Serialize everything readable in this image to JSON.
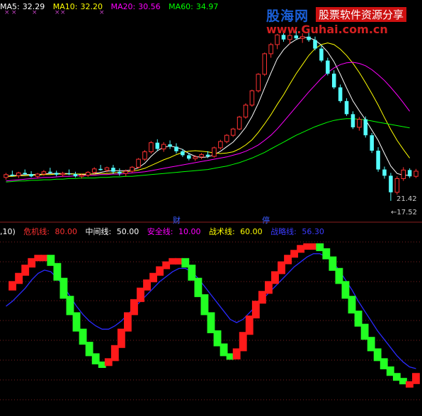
{
  "chart_data": [
    {
      "type": "candlestick",
      "legend": [
        {
          "label": "MA5:",
          "value": "32.29",
          "color": "#ffffff"
        },
        {
          "label": "MA10:",
          "value": "32.20",
          "color": "#ffff00"
        },
        {
          "label": "MA20:",
          "value": "30.56",
          "color": "#ff00ff"
        },
        {
          "label": "MA60:",
          "value": "34.97",
          "color": "#00ff00"
        }
      ],
      "ylim": [
        15.5,
        49
      ],
      "candles": [
        {
          "o": 21.6,
          "h": 22.4,
          "l": 21.2,
          "c": 22.1
        },
        {
          "o": 22.1,
          "h": 22.8,
          "l": 21.8,
          "c": 21.9
        },
        {
          "o": 21.9,
          "h": 22.6,
          "l": 21.5,
          "c": 22.4
        },
        {
          "o": 22.4,
          "h": 23.0,
          "l": 22.0,
          "c": 22.2
        },
        {
          "o": 22.2,
          "h": 22.7,
          "l": 21.6,
          "c": 21.8
        },
        {
          "o": 21.8,
          "h": 22.4,
          "l": 21.4,
          "c": 22.2
        },
        {
          "o": 22.2,
          "h": 22.9,
          "l": 21.9,
          "c": 22.6
        },
        {
          "o": 22.6,
          "h": 23.3,
          "l": 22.2,
          "c": 22.4
        },
        {
          "o": 22.4,
          "h": 22.8,
          "l": 21.8,
          "c": 22.1
        },
        {
          "o": 22.1,
          "h": 22.6,
          "l": 21.7,
          "c": 22.3
        },
        {
          "o": 22.3,
          "h": 23.0,
          "l": 22.0,
          "c": 22.2
        },
        {
          "o": 22.2,
          "h": 22.6,
          "l": 21.6,
          "c": 21.8
        },
        {
          "o": 21.8,
          "h": 22.3,
          "l": 21.4,
          "c": 22.0
        },
        {
          "o": 22.0,
          "h": 22.7,
          "l": 21.7,
          "c": 22.5
        },
        {
          "o": 22.5,
          "h": 23.4,
          "l": 22.2,
          "c": 23.1
        },
        {
          "o": 23.1,
          "h": 23.8,
          "l": 22.8,
          "c": 22.9
        },
        {
          "o": 22.9,
          "h": 23.5,
          "l": 22.5,
          "c": 23.3
        },
        {
          "o": 23.3,
          "h": 23.8,
          "l": 22.2,
          "c": 22.6
        },
        {
          "o": 22.6,
          "h": 23.2,
          "l": 21.9,
          "c": 22.3
        },
        {
          "o": 22.3,
          "h": 23.0,
          "l": 21.8,
          "c": 22.7
        },
        {
          "o": 22.7,
          "h": 23.6,
          "l": 22.4,
          "c": 23.4
        },
        {
          "o": 23.4,
          "h": 25.0,
          "l": 23.2,
          "c": 24.8
        },
        {
          "o": 24.8,
          "h": 26.4,
          "l": 24.5,
          "c": 26.1
        },
        {
          "o": 26.1,
          "h": 28.0,
          "l": 25.8,
          "c": 27.7
        },
        {
          "o": 27.7,
          "h": 28.3,
          "l": 26.2,
          "c": 26.6
        },
        {
          "o": 26.6,
          "h": 27.8,
          "l": 26.1,
          "c": 27.4
        },
        {
          "o": 27.4,
          "h": 28.1,
          "l": 26.6,
          "c": 27.0
        },
        {
          "o": 27.0,
          "h": 27.6,
          "l": 25.8,
          "c": 26.2
        },
        {
          "o": 26.2,
          "h": 26.6,
          "l": 25.2,
          "c": 25.5
        },
        {
          "o": 25.5,
          "h": 25.9,
          "l": 24.6,
          "c": 24.9
        },
        {
          "o": 24.9,
          "h": 25.5,
          "l": 24.5,
          "c": 25.2
        },
        {
          "o": 25.2,
          "h": 25.9,
          "l": 24.8,
          "c": 25.6
        },
        {
          "o": 25.6,
          "h": 26.2,
          "l": 25.0,
          "c": 25.3
        },
        {
          "o": 25.3,
          "h": 27.0,
          "l": 25.1,
          "c": 26.8
        },
        {
          "o": 26.8,
          "h": 28.2,
          "l": 26.5,
          "c": 27.9
        },
        {
          "o": 27.9,
          "h": 29.2,
          "l": 27.6,
          "c": 29.0
        },
        {
          "o": 29.0,
          "h": 30.3,
          "l": 28.7,
          "c": 30.1
        },
        {
          "o": 30.1,
          "h": 32.4,
          "l": 29.9,
          "c": 32.2
        },
        {
          "o": 32.2,
          "h": 34.6,
          "l": 31.9,
          "c": 34.3
        },
        {
          "o": 34.3,
          "h": 37.0,
          "l": 34.0,
          "c": 36.8
        },
        {
          "o": 36.8,
          "h": 39.9,
          "l": 36.5,
          "c": 39.7
        },
        {
          "o": 39.7,
          "h": 43.5,
          "l": 39.4,
          "c": 43.3
        },
        {
          "o": 43.3,
          "h": 45.2,
          "l": 42.6,
          "c": 44.9
        },
        {
          "o": 44.9,
          "h": 46.8,
          "l": 44.1,
          "c": 46.6
        },
        {
          "o": 46.6,
          "h": 47.2,
          "l": 45.4,
          "c": 45.8
        },
        {
          "o": 45.8,
          "h": 46.9,
          "l": 45.0,
          "c": 46.5
        },
        {
          "o": 46.5,
          "h": 47.3,
          "l": 45.7,
          "c": 46.0
        },
        {
          "o": 46.0,
          "h": 46.9,
          "l": 45.2,
          "c": 46.3
        },
        {
          "o": 46.3,
          "h": 47.0,
          "l": 45.4,
          "c": 45.7
        },
        {
          "o": 45.7,
          "h": 46.3,
          "l": 43.9,
          "c": 44.2
        },
        {
          "o": 44.2,
          "h": 44.8,
          "l": 41.8,
          "c": 42.1
        },
        {
          "o": 42.1,
          "h": 42.6,
          "l": 39.5,
          "c": 39.8
        },
        {
          "o": 39.8,
          "h": 40.4,
          "l": 37.1,
          "c": 37.4
        },
        {
          "o": 37.4,
          "h": 37.9,
          "l": 34.7,
          "c": 35.0
        },
        {
          "o": 35.0,
          "h": 35.5,
          "l": 32.4,
          "c": 32.7
        },
        {
          "o": 32.7,
          "h": 33.2,
          "l": 30.1,
          "c": 30.4
        },
        {
          "o": 30.4,
          "h": 32.2,
          "l": 29.8,
          "c": 31.8
        },
        {
          "o": 31.8,
          "h": 32.3,
          "l": 28.6,
          "c": 29.0
        },
        {
          "o": 29.0,
          "h": 29.4,
          "l": 25.9,
          "c": 26.3
        },
        {
          "o": 26.3,
          "h": 26.9,
          "l": 22.6,
          "c": 23.0
        },
        {
          "o": 23.0,
          "h": 23.5,
          "l": 21.4,
          "c": 21.9
        },
        {
          "o": 21.9,
          "h": 22.4,
          "l": 17.5,
          "c": 19.0
        },
        {
          "o": 19.0,
          "h": 21.8,
          "l": 18.6,
          "c": 21.4
        },
        {
          "o": 21.4,
          "h": 23.4,
          "l": 21.0,
          "c": 22.9
        },
        {
          "o": 22.9,
          "h": 23.2,
          "l": 21.5,
          "c": 21.8
        },
        {
          "o": 21.8,
          "h": 23.1,
          "l": 21.5,
          "c": 22.7
        }
      ],
      "ma": [
        {
          "name": "MA5",
          "color": "#ffffff",
          "values": [
            21.8,
            21.9,
            22.0,
            22.1,
            22.1,
            22.1,
            22.2,
            22.3,
            22.3,
            22.3,
            22.3,
            22.2,
            22.1,
            22.1,
            22.3,
            22.5,
            22.7,
            22.8,
            22.8,
            22.8,
            22.9,
            23.3,
            24.1,
            25.3,
            26.3,
            26.9,
            27.1,
            26.9,
            26.5,
            25.8,
            25.3,
            25.1,
            25.2,
            25.6,
            26.2,
            27.0,
            27.8,
            29.0,
            30.4,
            32.3,
            34.6,
            37.3,
            39.9,
            42.4,
            44.0,
            45.1,
            45.8,
            46.2,
            46.1,
            45.7,
            44.8,
            43.6,
            41.9,
            39.7,
            37.3,
            35.0,
            33.3,
            31.7,
            29.9,
            28.1,
            25.8,
            23.6,
            22.3,
            22.0,
            22.0
          ]
        },
        {
          "name": "MA10",
          "color": "#ffff00",
          "values": [
            21.8,
            21.8,
            21.9,
            21.9,
            22.0,
            22.0,
            22.1,
            22.1,
            22.2,
            22.2,
            22.2,
            22.2,
            22.2,
            22.2,
            22.2,
            22.3,
            22.3,
            22.4,
            22.5,
            22.6,
            22.7,
            22.9,
            23.2,
            23.7,
            24.2,
            24.7,
            25.1,
            25.6,
            26.0,
            26.2,
            26.3,
            26.2,
            26.1,
            25.9,
            25.8,
            25.9,
            26.1,
            26.6,
            27.3,
            28.2,
            29.5,
            31.0,
            32.6,
            34.4,
            36.1,
            38.0,
            39.8,
            41.4,
            43.0,
            44.2,
            44.9,
            45.2,
            44.9,
            44.1,
            43.0,
            41.6,
            40.0,
            38.2,
            36.3,
            34.3,
            32.1,
            30.0,
            28.1,
            26.5,
            25.0
          ]
        },
        {
          "name": "MA20",
          "color": "#ff00ff",
          "values": [
            21.0,
            21.1,
            21.2,
            21.3,
            21.4,
            21.5,
            21.6,
            21.6,
            21.7,
            21.8,
            21.8,
            21.9,
            21.9,
            22.0,
            22.0,
            22.1,
            22.1,
            22.2,
            22.2,
            22.3,
            22.4,
            22.5,
            22.6,
            22.8,
            23.0,
            23.2,
            23.4,
            23.6,
            23.8,
            24.0,
            24.2,
            24.4,
            24.6,
            24.8,
            25.0,
            25.2,
            25.5,
            25.8,
            26.2,
            26.7,
            27.3,
            28.1,
            29.0,
            30.1,
            31.4,
            32.7,
            34.0,
            35.3,
            36.6,
            37.8,
            39.0,
            40.0,
            40.8,
            41.4,
            41.7,
            41.8,
            41.6,
            41.2,
            40.5,
            39.6,
            38.6,
            37.4,
            36.1,
            34.7,
            33.2
          ]
        },
        {
          "name": "MA60",
          "color": "#00ff00",
          "values": [
            20.8,
            20.9,
            21.0,
            21.0,
            21.1,
            21.1,
            21.2,
            21.2,
            21.3,
            21.3,
            21.4,
            21.4,
            21.5,
            21.5,
            21.5,
            21.6,
            21.6,
            21.7,
            21.7,
            21.8,
            21.8,
            21.9,
            22.0,
            22.1,
            22.2,
            22.3,
            22.4,
            22.5,
            22.6,
            22.7,
            22.8,
            22.9,
            23.0,
            23.2,
            23.4,
            23.6,
            23.9,
            24.2,
            24.6,
            25.0,
            25.5,
            26.0,
            26.6,
            27.2,
            27.8,
            28.4,
            29.0,
            29.5,
            30.0,
            30.5,
            30.9,
            31.3,
            31.6,
            31.8,
            31.9,
            31.9,
            31.8,
            31.7,
            31.5,
            31.3,
            31.1,
            30.9,
            30.7,
            30.5,
            30.3
          ]
        }
      ],
      "annotations": {
        "high_label": "21.42",
        "low_label": "17.52",
        "mark_1": "财",
        "mark_2": "停"
      }
    },
    {
      "type": "line",
      "legend": [
        {
          "label": ",10)",
          "value": "",
          "color": "#ffffff"
        },
        {
          "label": "危机线:",
          "value": "80.00",
          "color": "#ff3030"
        },
        {
          "label": "中间线:",
          "value": "50.00",
          "color": "#ffffff"
        },
        {
          "label": "安全线:",
          "value": "10.00",
          "color": "#ff00ff"
        },
        {
          "label": "战术线:",
          "value": "60.00",
          "color": "#ffff00"
        },
        {
          "label": "战略线:",
          "value": "56.30",
          "color": "#3b3bff"
        }
      ],
      "ylim": [
        0,
        100
      ],
      "k": [
        70,
        74,
        79,
        84,
        88,
        90,
        90,
        85,
        76,
        65,
        55,
        45,
        37,
        30,
        25,
        24,
        27,
        35,
        45,
        55,
        63,
        70,
        75,
        79,
        83,
        86,
        88,
        88,
        84,
        76,
        66,
        55,
        44,
        36,
        30,
        28,
        33,
        43,
        53,
        62,
        68,
        74,
        80,
        86,
        90,
        93,
        96,
        97,
        97,
        94,
        89,
        82,
        74,
        65,
        56,
        48,
        40,
        33,
        27,
        22,
        18,
        15,
        13,
        13,
        18
      ],
      "d": [
        60,
        63,
        67,
        71,
        76,
        80,
        82,
        81,
        77,
        72,
        66,
        60,
        55,
        51,
        48,
        46,
        46,
        48,
        51,
        55,
        59,
        63,
        67,
        71,
        75,
        78,
        81,
        83,
        83,
        81,
        77,
        72,
        67,
        62,
        57,
        52,
        50,
        52,
        56,
        60,
        64,
        68,
        72,
        76,
        80,
        84,
        87,
        90,
        92,
        92,
        90,
        87,
        82,
        76,
        70,
        63,
        57,
        51,
        45,
        40,
        35,
        30,
        26,
        23,
        22
      ]
    }
  ],
  "watermark": {
    "logo": "股海网",
    "slogan": "股票软件资源分享",
    "url": "www.Guhai.com.cn"
  }
}
